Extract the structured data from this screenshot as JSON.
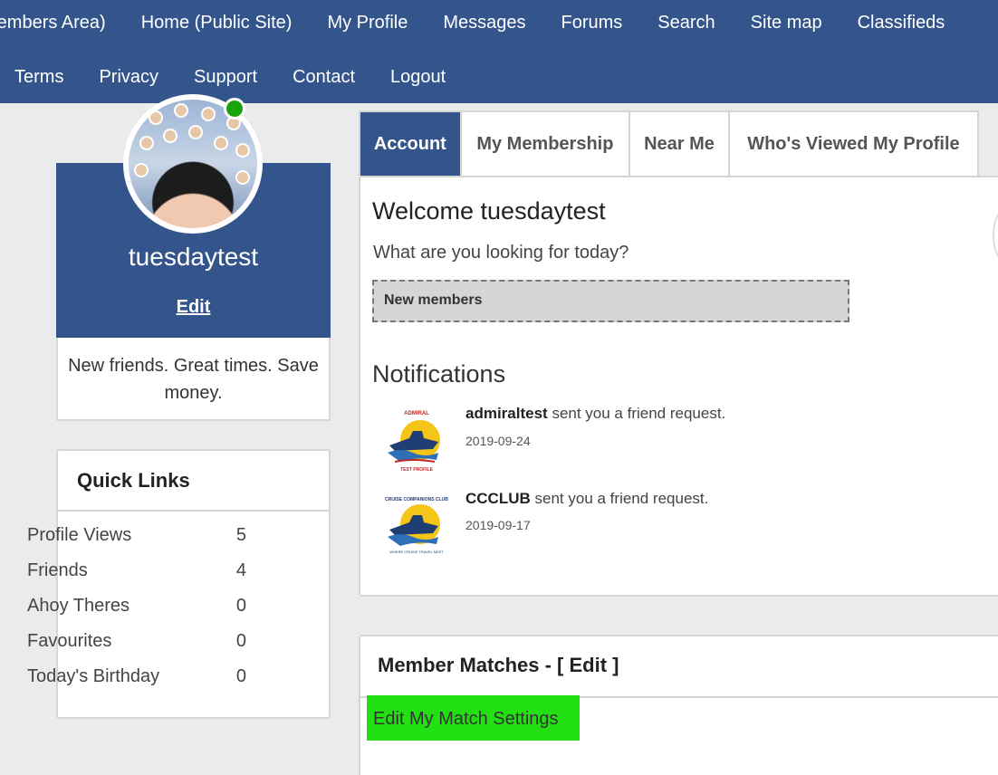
{
  "nav": {
    "row1": [
      "Members Area)",
      "Home (Public Site)",
      "My Profile",
      "Messages",
      "Forums",
      "Search",
      "Site map",
      "Classifieds"
    ],
    "row2": [
      "Terms",
      "Privacy",
      "Support",
      "Contact",
      "Logout"
    ]
  },
  "profile": {
    "username": "tuesdaytest",
    "edit_label": "Edit",
    "tagline": "New friends. Great times. Save money."
  },
  "quick_links": {
    "title": "Quick Links",
    "items": [
      {
        "label": "Profile Views",
        "count": "5"
      },
      {
        "label": "Friends",
        "count": "4"
      },
      {
        "label": "Ahoy Theres",
        "count": "0"
      },
      {
        "label": "Favourites",
        "count": "0"
      },
      {
        "label": "Today's Birthday",
        "count": "0"
      }
    ]
  },
  "tabs": [
    "Account",
    "My Membership",
    "Near Me",
    "Who's Viewed My Profile"
  ],
  "main": {
    "welcome": "Welcome tuesdaytest",
    "looking": "What are you looking for today?",
    "new_members": "New members",
    "notifications_title": "Notifications",
    "notifications": [
      {
        "user": "admiraltest",
        "text": "sent you a friend request.",
        "date": "2019-09-24",
        "logo_top": "ADMIRAL",
        "logo_bottom": "TEST PROFILE"
      },
      {
        "user": "CCCLUB",
        "text": "sent you a friend request.",
        "date": "2019-09-17",
        "logo_top": "CRUISE COMPANIONS CLUB",
        "logo_bottom": "WHERE CRUISE TRAVEL MEET"
      }
    ]
  },
  "matches": {
    "title": "Member Matches - [ Edit ]",
    "settings_link": "Edit My Match Settings"
  },
  "colors": {
    "brand": "#34558b",
    "highlight": "#22e012",
    "online": "#18a20c"
  }
}
